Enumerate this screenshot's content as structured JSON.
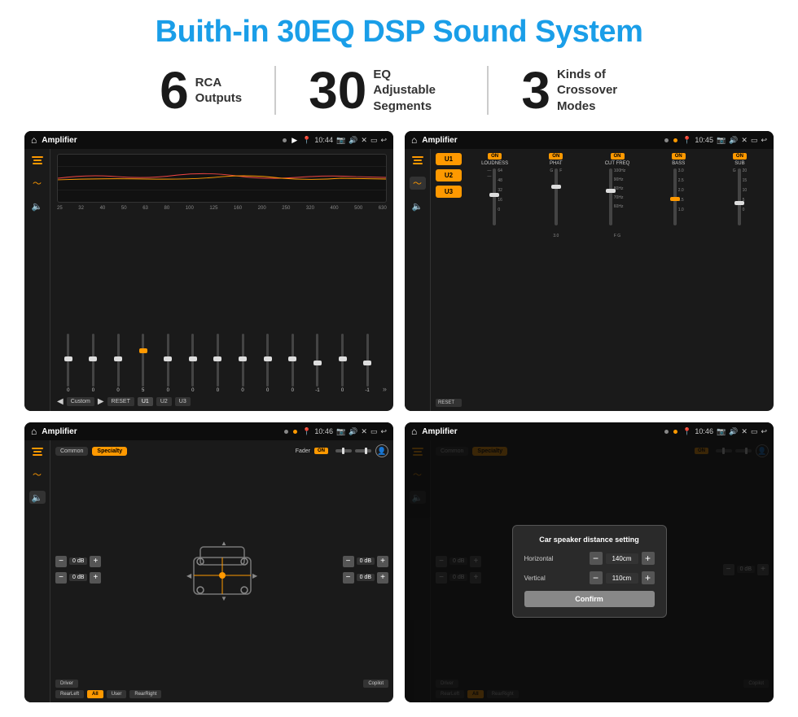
{
  "title": "Buith-in 30EQ DSP Sound System",
  "stats": [
    {
      "number": "6",
      "label": "RCA\nOutputs"
    },
    {
      "number": "30",
      "label": "EQ Adjustable\nSegments"
    },
    {
      "number": "3",
      "label": "Kinds of\nCrossover Modes"
    }
  ],
  "screens": {
    "eq": {
      "title": "Amplifier",
      "time": "10:44",
      "eq_labels": [
        "25",
        "32",
        "40",
        "50",
        "63",
        "80",
        "100",
        "125",
        "160",
        "200",
        "250",
        "320",
        "400",
        "500",
        "630"
      ],
      "values": [
        "0",
        "0",
        "0",
        "5",
        "0",
        "0",
        "0",
        "0",
        "0",
        "0",
        "-1",
        "0",
        "-1"
      ],
      "preset": "Custom",
      "buttons": [
        "RESET",
        "U1",
        "U2",
        "U3"
      ]
    },
    "crossover": {
      "title": "Amplifier",
      "time": "10:45",
      "channels": [
        "LOUDNESS",
        "PHAT",
        "CUT FREQ",
        "BASS",
        "SUB"
      ],
      "u_labels": [
        "U1",
        "U2",
        "U3"
      ]
    },
    "speaker": {
      "title": "Amplifier",
      "time": "10:46",
      "modes": [
        "Common",
        "Specialty"
      ],
      "active_mode": "Specialty",
      "fader_label": "Fader",
      "fader_on": "ON",
      "positions": [
        "Driver",
        "Copilot",
        "RearLeft",
        "RearRight",
        "All",
        "User"
      ],
      "active_position": "All",
      "db_values": [
        "0 dB",
        "0 dB",
        "0 dB",
        "0 dB"
      ]
    },
    "dialog": {
      "title": "Amplifier",
      "time": "10:46",
      "dialog_title": "Car speaker distance setting",
      "horizontal_label": "Horizontal",
      "horizontal_value": "140cm",
      "vertical_label": "Vertical",
      "vertical_value": "110cm",
      "confirm_label": "Confirm",
      "modes": [
        "Common",
        "Specialty"
      ],
      "db_values": [
        "0 dB",
        "0 dB"
      ]
    }
  }
}
